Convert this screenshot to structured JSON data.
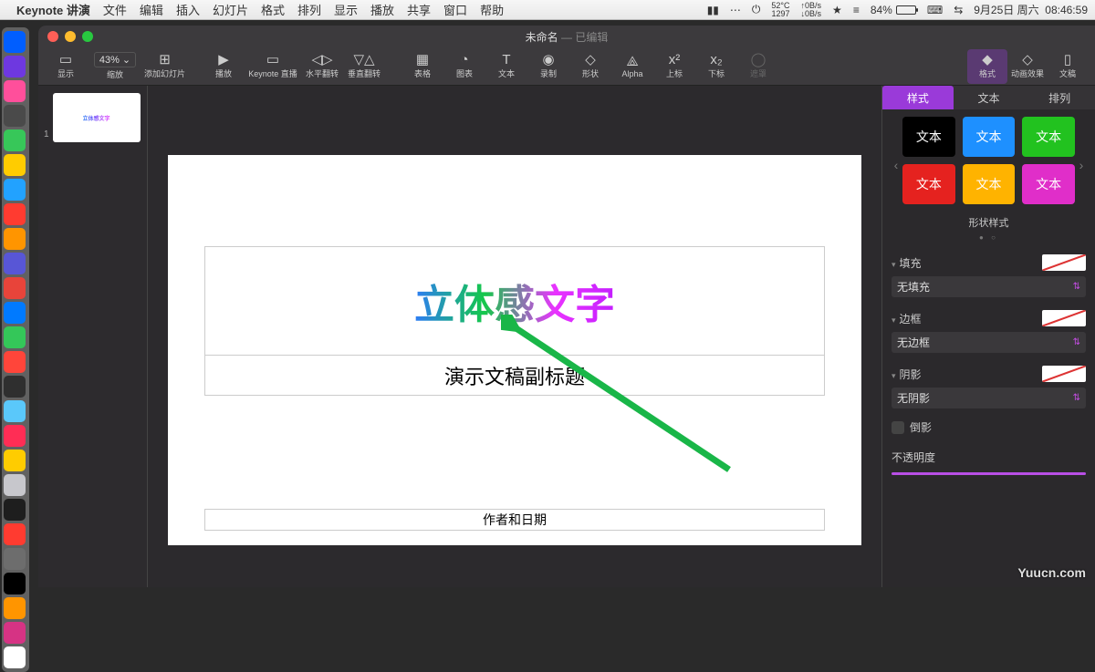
{
  "menubar": {
    "app_name": "Keynote 讲演",
    "items": [
      "文件",
      "编辑",
      "插入",
      "幻灯片",
      "格式",
      "排列",
      "显示",
      "播放",
      "共享",
      "窗口",
      "帮助"
    ],
    "temp_top": "52°C",
    "temp_bottom": "1297",
    "net_top": "↑0B/s",
    "net_bottom": "↓0B/s",
    "battery_pct": "84%",
    "date": "9月25日 周六",
    "time": "08:46:59"
  },
  "window": {
    "title": "未命名",
    "edited": "— 已编辑"
  },
  "toolbar": {
    "view": "显示",
    "zoom_val": "43%",
    "zoom": "缩放",
    "add": "添加幻灯片",
    "play": "播放",
    "live": "Keynote 直播",
    "fliph": "水平翻转",
    "flipv": "垂直翻转",
    "table": "表格",
    "chart": "图表",
    "text": "文本",
    "record": "录制",
    "shape": "形状",
    "alpha": "Alpha",
    "sup": "上标",
    "sub": "下标",
    "mask": "遮罩",
    "format": "格式",
    "anim": "动画效果",
    "doc": "文稿"
  },
  "slides": {
    "num": "1"
  },
  "slide": {
    "title": "立体感文字",
    "subtitle": "演示文稿副标题",
    "footer": "作者和日期"
  },
  "inspector": {
    "tabs": {
      "style": "样式",
      "text": "文本",
      "arrange": "排列"
    },
    "swatch_label": "文本",
    "shape_styles": "形状样式",
    "fill": "填充",
    "fill_value": "无填充",
    "border": "边框",
    "border_value": "无边框",
    "shadow": "阴影",
    "shadow_value": "无阴影",
    "reflection": "倒影",
    "opacity": "不透明度"
  },
  "dock_colors": [
    "#005eff",
    "#6e38e0",
    "#ff4f9b",
    "#4a4a4a",
    "#37c759",
    "#ffcc00",
    "#22a2ff",
    "#ff3b30",
    "#ff9500",
    "#5856d6",
    "#e8443a",
    "#007aff",
    "#34c759",
    "#ff453a",
    "#2f2f2f",
    "#5ac8fa",
    "#ff2d55",
    "#ffcc00",
    "#c7c7cc",
    "#1e1e1e",
    "#ff3b30",
    "#6d6d6d",
    "#000000",
    "#ff9500",
    "#d63384",
    "#ffffff"
  ],
  "watermark": "Yuucn.com"
}
